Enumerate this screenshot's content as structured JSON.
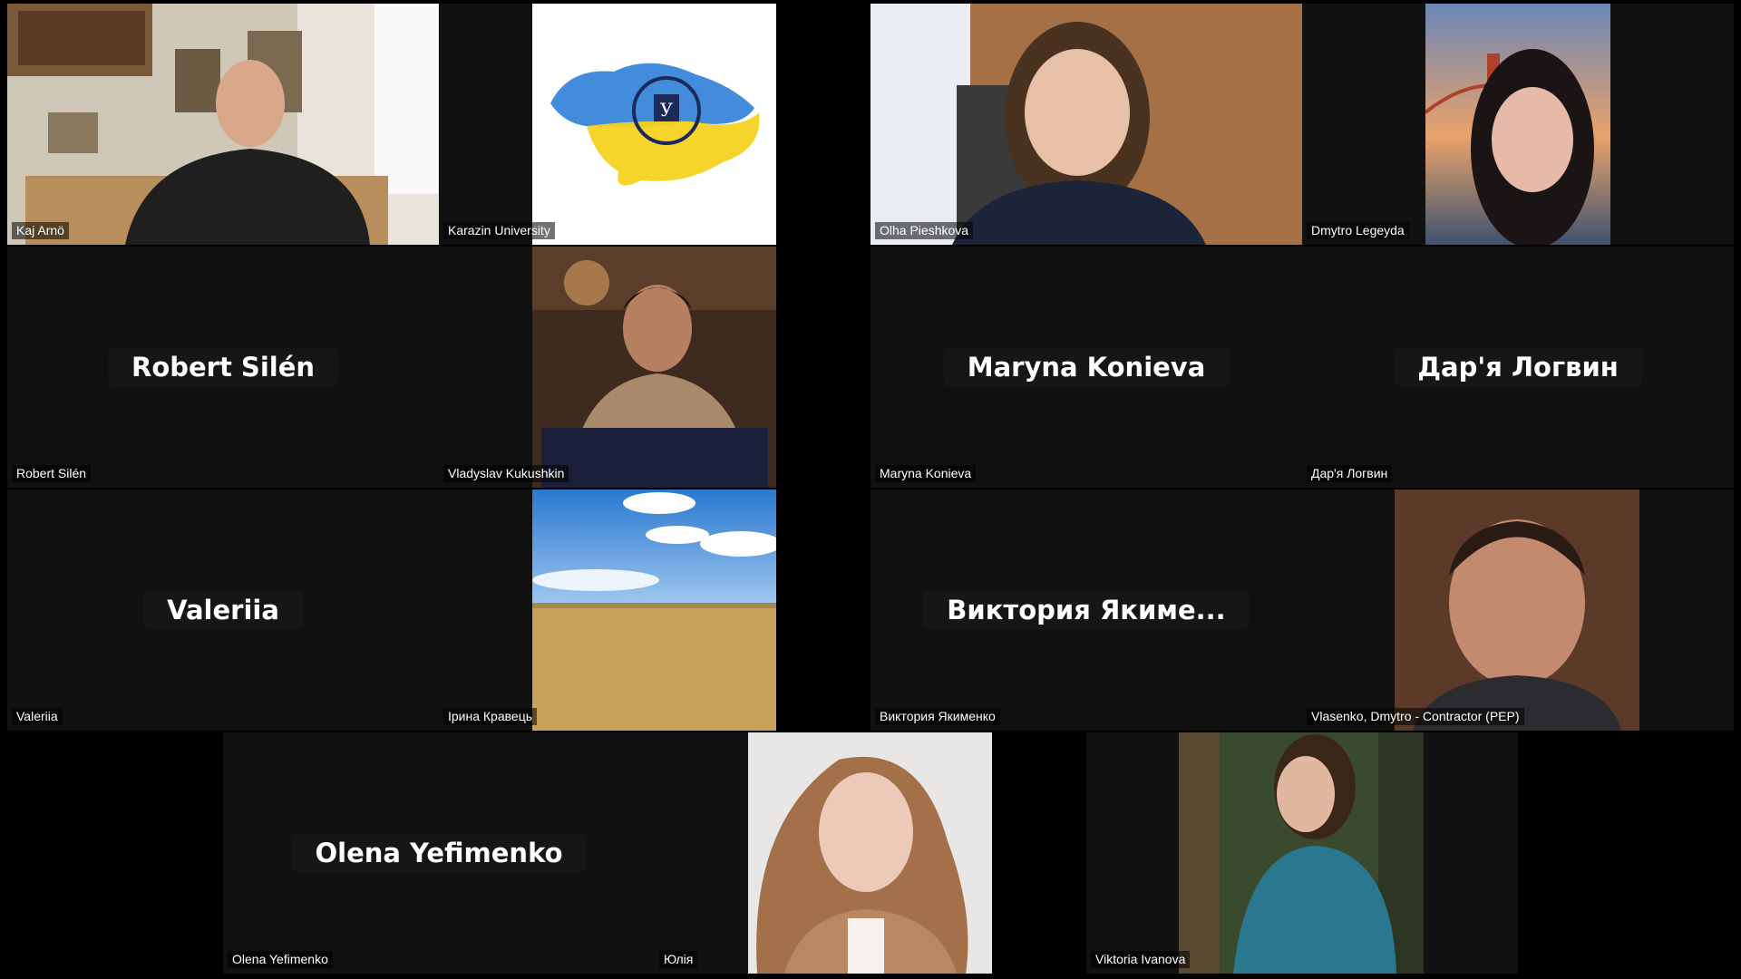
{
  "meeting": {
    "participants": [
      {
        "id": "kaj",
        "label": "Kaj Arnö",
        "video": true
      },
      {
        "id": "karazin",
        "label": "Karazin University",
        "video": true
      },
      {
        "id": "olha",
        "label": "Olha Pieshkova",
        "video": true
      },
      {
        "id": "dmytro_l",
        "label": "Dmytro Legeyda",
        "video": true
      },
      {
        "id": "robert",
        "label": "Robert Silén",
        "center": "Robert Silén",
        "video": false
      },
      {
        "id": "vladyslav",
        "label": "Vladyslav Kukushkin",
        "video": true
      },
      {
        "id": "maryna",
        "label": "Maryna Konieva",
        "center": "Maryna Konieva",
        "video": false
      },
      {
        "id": "darya",
        "label": "Дар'я Логвин",
        "center": "Дар'я Логвин",
        "video": false
      },
      {
        "id": "valeriia",
        "label": "Valeriia",
        "center": "Valeriia",
        "video": false
      },
      {
        "id": "iryna",
        "label": "Ірина Кравець",
        "video": true
      },
      {
        "id": "viktoriya_ya",
        "label": "Виктория Якименко",
        "center": "Виктория  Якиме...",
        "video": false
      },
      {
        "id": "vlasenko",
        "label": "Vlasenko, Dmytro - Contractor (PEP)",
        "video": true
      },
      {
        "id": "olena",
        "label": "Olena Yefimenko",
        "center": "Olena Yefimenko",
        "video": false
      },
      {
        "id": "yuliia",
        "label": "Юлія",
        "video": true
      },
      {
        "id": "viktoria_iv",
        "label": "Viktoria Ivanova",
        "video": true
      }
    ]
  },
  "colors": {
    "background": "#000000",
    "tile": "#111111",
    "ukraine_blue": "#2f7fd8",
    "ukraine_yellow": "#f6d21f"
  }
}
